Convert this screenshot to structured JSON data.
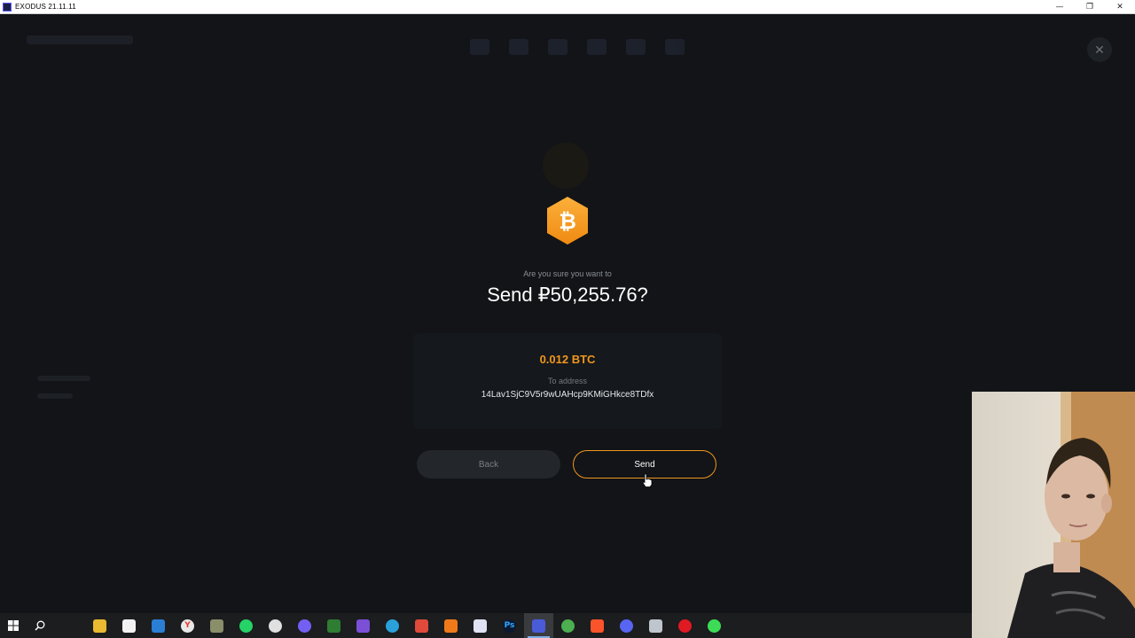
{
  "window": {
    "title": "EXODUS 21.11.11",
    "controls": {
      "minimize": "—",
      "restore": "❐",
      "close": "✕"
    }
  },
  "dialog": {
    "close_glyph": "✕",
    "coin_icon": "bitcoin-icon",
    "confirm_label": "Are you sure you want to",
    "confirm_amount": "Send ₽50,255.76?",
    "crypto_amount": "0.012 BTC",
    "to_label": "To address",
    "address": "14Lav1SjC9V5r9wUAHcp9KMiGHkce8TDfx",
    "back_label": "Back",
    "send_label": "Send"
  },
  "colors": {
    "accent": "#f0961f",
    "bitcoin": "#f7931a",
    "background": "#121417"
  },
  "taskbar": {
    "start_icon": "windows-start-icon",
    "search_icon": "search-icon",
    "apps": [
      {
        "name": "file-explorer-icon",
        "glyph": "",
        "color": "#e8b931"
      },
      {
        "name": "store-icon",
        "glyph": "",
        "color": "#f2f2f2"
      },
      {
        "name": "mail-icon",
        "glyph": "",
        "color": "#2a7fd4"
      },
      {
        "name": "yandex-browser-icon",
        "glyph": "Y",
        "color": "#e8e8e8"
      },
      {
        "name": "app-icon",
        "glyph": "",
        "color": "#8a8f6a"
      },
      {
        "name": "whatsapp-icon",
        "glyph": "",
        "color": "#25d366"
      },
      {
        "name": "photos-icon",
        "glyph": "",
        "color": "#e0e0e0"
      },
      {
        "name": "viber-icon",
        "glyph": "",
        "color": "#7360f2"
      },
      {
        "name": "app-icon-green",
        "glyph": "",
        "color": "#2e7d32"
      },
      {
        "name": "vs-icon",
        "glyph": "",
        "color": "#7b4fd6"
      },
      {
        "name": "telegram-icon",
        "glyph": "",
        "color": "#2aa1da"
      },
      {
        "name": "app-icon-red",
        "glyph": "",
        "color": "#e04a3a"
      },
      {
        "name": "avast-icon",
        "glyph": "",
        "color": "#f07a1a"
      },
      {
        "name": "metamask-icon",
        "glyph": "",
        "color": "#dfe3f3"
      },
      {
        "name": "photoshop-icon",
        "glyph": "Ps",
        "color": "#0b1a33"
      },
      {
        "name": "exodus-icon",
        "glyph": "",
        "color": "#4a5bd8"
      },
      {
        "name": "chrome-icon",
        "glyph": "",
        "color": "#4caf50"
      },
      {
        "name": "brave-icon",
        "glyph": "",
        "color": "#fb542b"
      },
      {
        "name": "discord-icon",
        "glyph": "",
        "color": "#5865f2"
      },
      {
        "name": "calculator-icon",
        "glyph": "",
        "color": "#bfc5cc"
      },
      {
        "name": "opera-icon",
        "glyph": "",
        "color": "#e01a22"
      },
      {
        "name": "app-icon-circle",
        "glyph": "",
        "color": "#3ddc57"
      }
    ]
  }
}
